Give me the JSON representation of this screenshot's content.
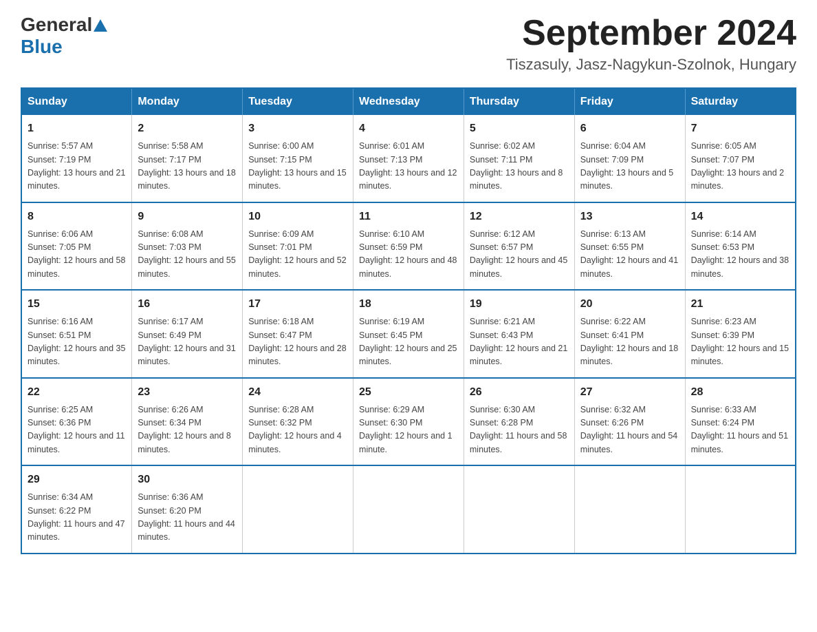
{
  "header": {
    "logo_general": "General",
    "logo_blue": "Blue",
    "month_title": "September 2024",
    "subtitle": "Tiszasuly, Jasz-Nagykun-Szolnok, Hungary"
  },
  "calendar": {
    "days_of_week": [
      "Sunday",
      "Monday",
      "Tuesday",
      "Wednesday",
      "Thursday",
      "Friday",
      "Saturday"
    ],
    "weeks": [
      [
        {
          "day": "1",
          "sunrise": "Sunrise: 5:57 AM",
          "sunset": "Sunset: 7:19 PM",
          "daylight": "Daylight: 13 hours and 21 minutes."
        },
        {
          "day": "2",
          "sunrise": "Sunrise: 5:58 AM",
          "sunset": "Sunset: 7:17 PM",
          "daylight": "Daylight: 13 hours and 18 minutes."
        },
        {
          "day": "3",
          "sunrise": "Sunrise: 6:00 AM",
          "sunset": "Sunset: 7:15 PM",
          "daylight": "Daylight: 13 hours and 15 minutes."
        },
        {
          "day": "4",
          "sunrise": "Sunrise: 6:01 AM",
          "sunset": "Sunset: 7:13 PM",
          "daylight": "Daylight: 13 hours and 12 minutes."
        },
        {
          "day": "5",
          "sunrise": "Sunrise: 6:02 AM",
          "sunset": "Sunset: 7:11 PM",
          "daylight": "Daylight: 13 hours and 8 minutes."
        },
        {
          "day": "6",
          "sunrise": "Sunrise: 6:04 AM",
          "sunset": "Sunset: 7:09 PM",
          "daylight": "Daylight: 13 hours and 5 minutes."
        },
        {
          "day": "7",
          "sunrise": "Sunrise: 6:05 AM",
          "sunset": "Sunset: 7:07 PM",
          "daylight": "Daylight: 13 hours and 2 minutes."
        }
      ],
      [
        {
          "day": "8",
          "sunrise": "Sunrise: 6:06 AM",
          "sunset": "Sunset: 7:05 PM",
          "daylight": "Daylight: 12 hours and 58 minutes."
        },
        {
          "day": "9",
          "sunrise": "Sunrise: 6:08 AM",
          "sunset": "Sunset: 7:03 PM",
          "daylight": "Daylight: 12 hours and 55 minutes."
        },
        {
          "day": "10",
          "sunrise": "Sunrise: 6:09 AM",
          "sunset": "Sunset: 7:01 PM",
          "daylight": "Daylight: 12 hours and 52 minutes."
        },
        {
          "day": "11",
          "sunrise": "Sunrise: 6:10 AM",
          "sunset": "Sunset: 6:59 PM",
          "daylight": "Daylight: 12 hours and 48 minutes."
        },
        {
          "day": "12",
          "sunrise": "Sunrise: 6:12 AM",
          "sunset": "Sunset: 6:57 PM",
          "daylight": "Daylight: 12 hours and 45 minutes."
        },
        {
          "day": "13",
          "sunrise": "Sunrise: 6:13 AM",
          "sunset": "Sunset: 6:55 PM",
          "daylight": "Daylight: 12 hours and 41 minutes."
        },
        {
          "day": "14",
          "sunrise": "Sunrise: 6:14 AM",
          "sunset": "Sunset: 6:53 PM",
          "daylight": "Daylight: 12 hours and 38 minutes."
        }
      ],
      [
        {
          "day": "15",
          "sunrise": "Sunrise: 6:16 AM",
          "sunset": "Sunset: 6:51 PM",
          "daylight": "Daylight: 12 hours and 35 minutes."
        },
        {
          "day": "16",
          "sunrise": "Sunrise: 6:17 AM",
          "sunset": "Sunset: 6:49 PM",
          "daylight": "Daylight: 12 hours and 31 minutes."
        },
        {
          "day": "17",
          "sunrise": "Sunrise: 6:18 AM",
          "sunset": "Sunset: 6:47 PM",
          "daylight": "Daylight: 12 hours and 28 minutes."
        },
        {
          "day": "18",
          "sunrise": "Sunrise: 6:19 AM",
          "sunset": "Sunset: 6:45 PM",
          "daylight": "Daylight: 12 hours and 25 minutes."
        },
        {
          "day": "19",
          "sunrise": "Sunrise: 6:21 AM",
          "sunset": "Sunset: 6:43 PM",
          "daylight": "Daylight: 12 hours and 21 minutes."
        },
        {
          "day": "20",
          "sunrise": "Sunrise: 6:22 AM",
          "sunset": "Sunset: 6:41 PM",
          "daylight": "Daylight: 12 hours and 18 minutes."
        },
        {
          "day": "21",
          "sunrise": "Sunrise: 6:23 AM",
          "sunset": "Sunset: 6:39 PM",
          "daylight": "Daylight: 12 hours and 15 minutes."
        }
      ],
      [
        {
          "day": "22",
          "sunrise": "Sunrise: 6:25 AM",
          "sunset": "Sunset: 6:36 PM",
          "daylight": "Daylight: 12 hours and 11 minutes."
        },
        {
          "day": "23",
          "sunrise": "Sunrise: 6:26 AM",
          "sunset": "Sunset: 6:34 PM",
          "daylight": "Daylight: 12 hours and 8 minutes."
        },
        {
          "day": "24",
          "sunrise": "Sunrise: 6:28 AM",
          "sunset": "Sunset: 6:32 PM",
          "daylight": "Daylight: 12 hours and 4 minutes."
        },
        {
          "day": "25",
          "sunrise": "Sunrise: 6:29 AM",
          "sunset": "Sunset: 6:30 PM",
          "daylight": "Daylight: 12 hours and 1 minute."
        },
        {
          "day": "26",
          "sunrise": "Sunrise: 6:30 AM",
          "sunset": "Sunset: 6:28 PM",
          "daylight": "Daylight: 11 hours and 58 minutes."
        },
        {
          "day": "27",
          "sunrise": "Sunrise: 6:32 AM",
          "sunset": "Sunset: 6:26 PM",
          "daylight": "Daylight: 11 hours and 54 minutes."
        },
        {
          "day": "28",
          "sunrise": "Sunrise: 6:33 AM",
          "sunset": "Sunset: 6:24 PM",
          "daylight": "Daylight: 11 hours and 51 minutes."
        }
      ],
      [
        {
          "day": "29",
          "sunrise": "Sunrise: 6:34 AM",
          "sunset": "Sunset: 6:22 PM",
          "daylight": "Daylight: 11 hours and 47 minutes."
        },
        {
          "day": "30",
          "sunrise": "Sunrise: 6:36 AM",
          "sunset": "Sunset: 6:20 PM",
          "daylight": "Daylight: 11 hours and 44 minutes."
        },
        null,
        null,
        null,
        null,
        null
      ]
    ]
  }
}
